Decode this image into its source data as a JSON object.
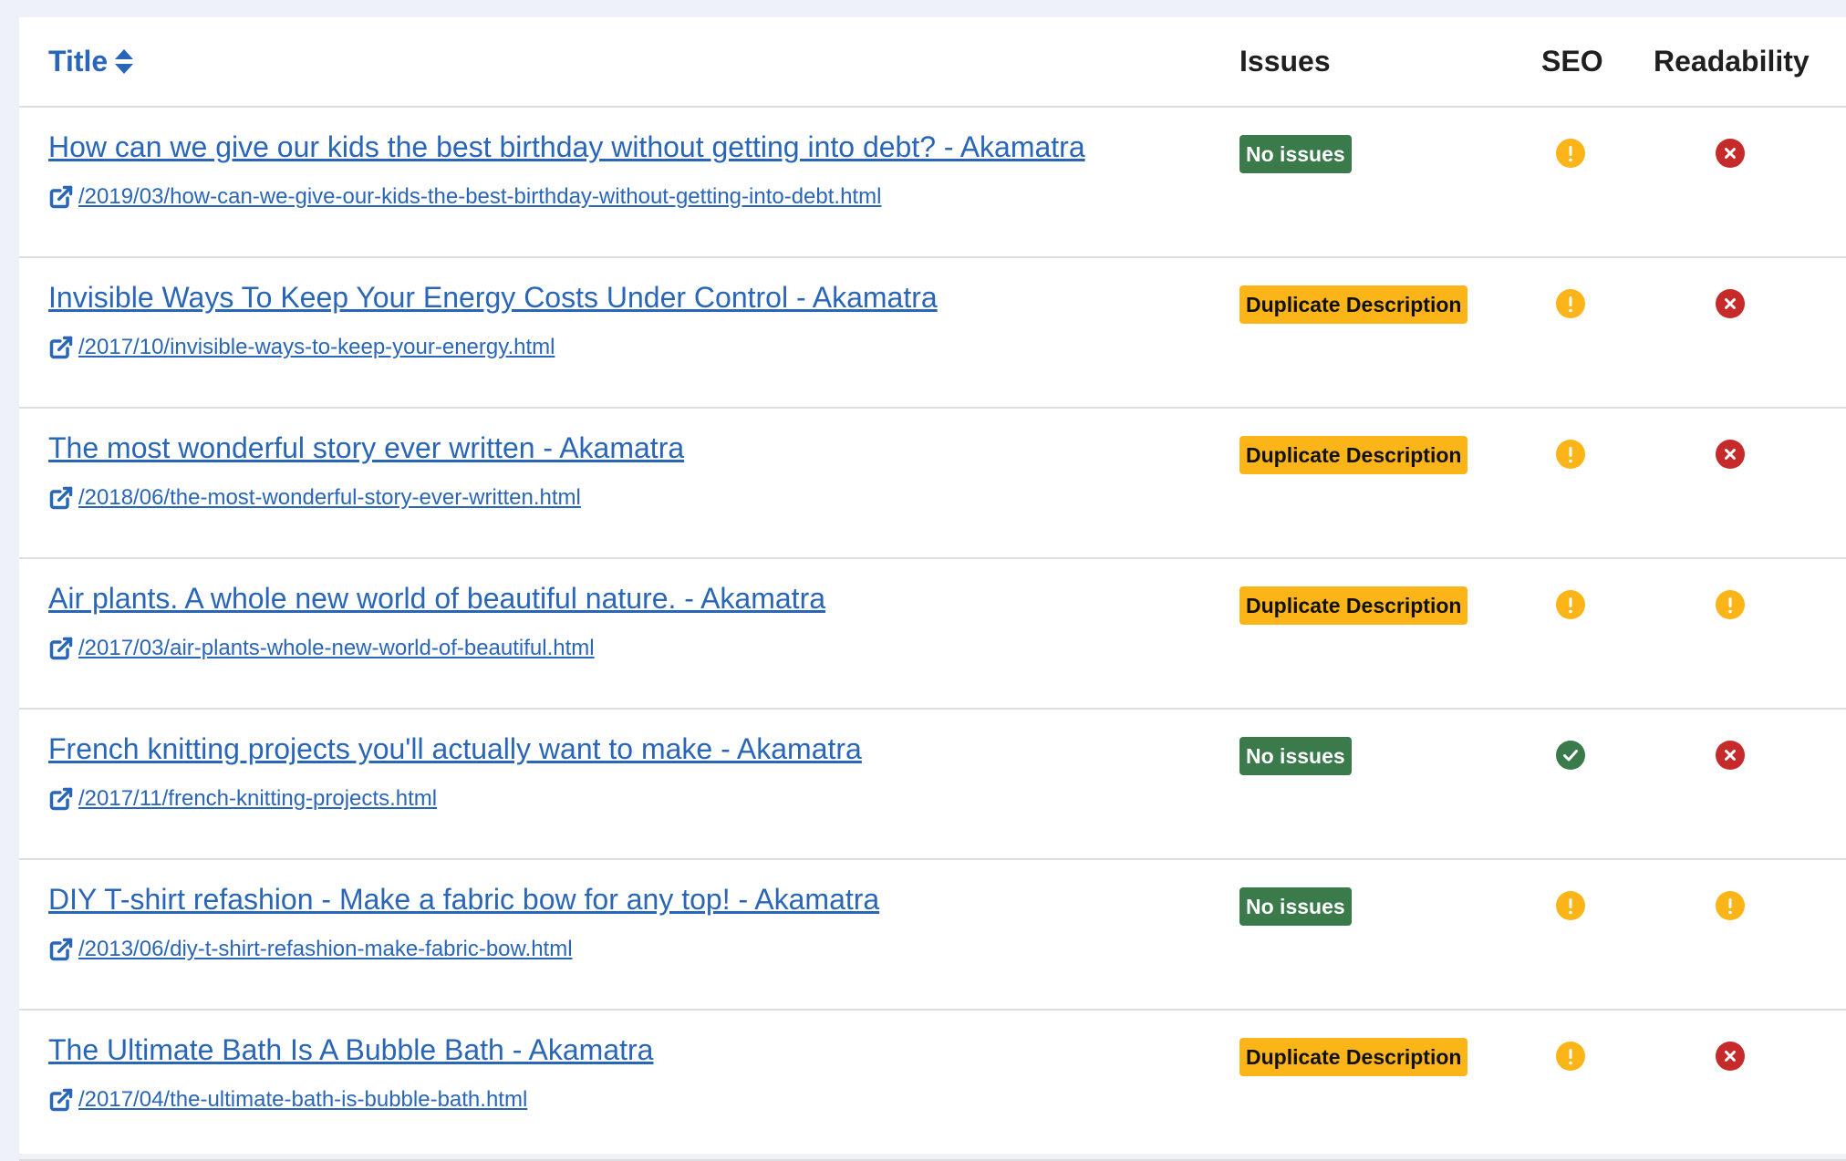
{
  "header": {
    "title_label": "Title",
    "issues_label": "Issues",
    "seo_label": "SEO",
    "readability_label": "Readability"
  },
  "colors": {
    "link": "#2a66b8",
    "ok_badge": "#3a7a4b",
    "warn_badge": "#fcb518",
    "status_good": "#3a7a4b",
    "status_warning": "#fcb518",
    "status_bad": "#c62a2a"
  },
  "rows": [
    {
      "title": "How can we give our kids the best birthday without getting into debt? - Akamatra",
      "url": "/2019/03/how-can-we-give-our-kids-the-best-birthday-without-getting-into-debt.html",
      "issues": "No issues",
      "issues_type": "ok",
      "seo": "warning",
      "readability": "bad"
    },
    {
      "title": "Invisible Ways To Keep Your Energy Costs Under Control - Akamatra",
      "url": "/2017/10/invisible-ways-to-keep-your-energy.html",
      "issues": "Duplicate Description",
      "issues_type": "warn",
      "seo": "warning",
      "readability": "bad"
    },
    {
      "title": "The most wonderful story ever written - Akamatra",
      "url": "/2018/06/the-most-wonderful-story-ever-written.html",
      "issues": "Duplicate Description",
      "issues_type": "warn",
      "seo": "warning",
      "readability": "bad"
    },
    {
      "title": "Air plants. A whole new world of beautiful nature. - Akamatra",
      "url": "/2017/03/air-plants-whole-new-world-of-beautiful.html",
      "issues": "Duplicate Description",
      "issues_type": "warn",
      "seo": "warning",
      "readability": "warning"
    },
    {
      "title": "French knitting projects you'll actually want to make - Akamatra",
      "url": "/2017/11/french-knitting-projects.html",
      "issues": "No issues",
      "issues_type": "ok",
      "seo": "good",
      "readability": "bad"
    },
    {
      "title": "DIY T-shirt refashion - Make a fabric bow for any top! - Akamatra",
      "url": "/2013/06/diy-t-shirt-refashion-make-fabric-bow.html",
      "issues": "No issues",
      "issues_type": "ok",
      "seo": "warning",
      "readability": "warning"
    },
    {
      "title": "The Ultimate Bath Is A Bubble Bath - Akamatra",
      "url": "/2017/04/the-ultimate-bath-is-bubble-bath.html",
      "issues": "Duplicate Description",
      "issues_type": "warn",
      "seo": "warning",
      "readability": "bad"
    }
  ]
}
